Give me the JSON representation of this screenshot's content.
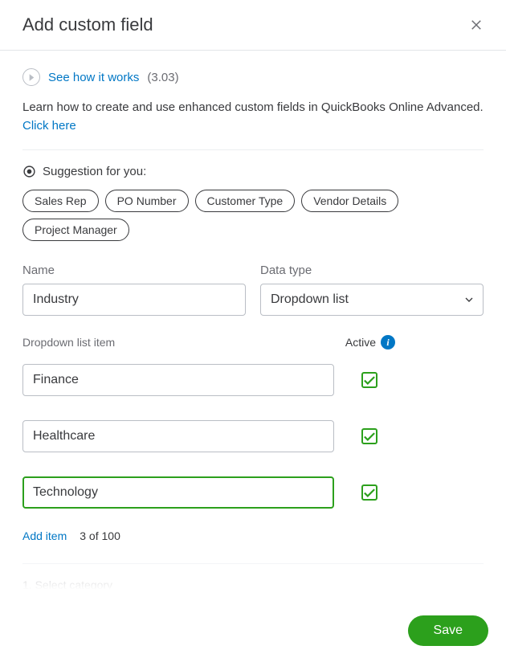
{
  "header": {
    "title": "Add custom field"
  },
  "howItWorks": {
    "label": "See how it works",
    "timecode": "(3.03)"
  },
  "description": {
    "text": "Learn how to create and use enhanced custom fields in QuickBooks Online Advanced. ",
    "link": "Click here"
  },
  "suggestion": {
    "label": "Suggestion for you:",
    "chips": [
      "Sales Rep",
      "PO Number",
      "Customer Type",
      "Vendor Details",
      "Project Manager"
    ]
  },
  "form": {
    "name": {
      "label": "Name",
      "value": "Industry"
    },
    "dataType": {
      "label": "Data type",
      "value": "Dropdown list"
    }
  },
  "list": {
    "header": "Dropdown list item",
    "activeLabel": "Active",
    "infoGlyph": "i",
    "items": [
      {
        "value": "Finance",
        "active": true,
        "focused": false
      },
      {
        "value": "Healthcare",
        "active": true,
        "focused": false
      },
      {
        "value": "Technology",
        "active": true,
        "focused": true
      }
    ],
    "addLabel": "Add item",
    "count": "3 of 100"
  },
  "step": {
    "label": "1. Select category"
  },
  "footer": {
    "save": "Save"
  }
}
